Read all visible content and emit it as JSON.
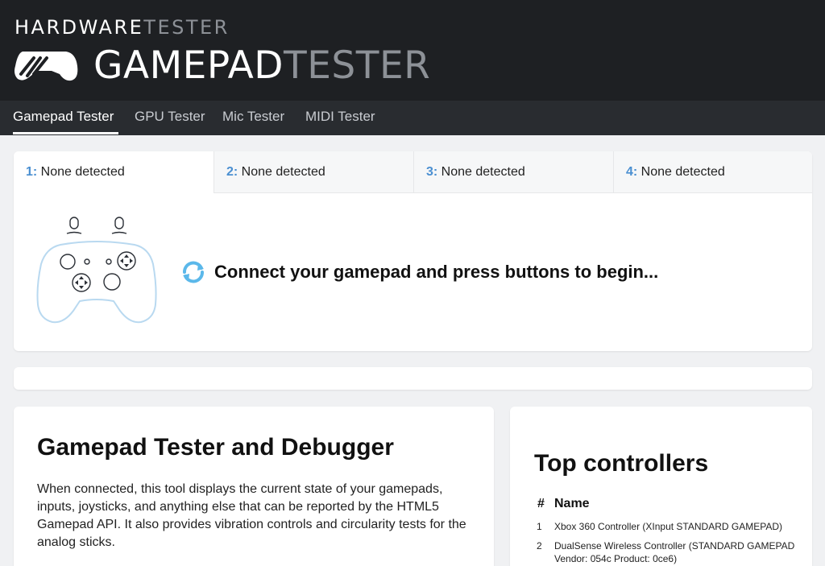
{
  "brand": {
    "top_white": "HARDWARE",
    "top_gray": "TESTER",
    "main_white": "GAMEPAD",
    "main_gray": "TESTER",
    "logo_icon": "gamepad-logo-icon"
  },
  "nav": {
    "items": [
      {
        "label": "Gamepad Tester",
        "active": true
      },
      {
        "label": "GPU Tester",
        "active": false
      },
      {
        "label": "Mic Tester",
        "active": false
      },
      {
        "label": "MIDI Tester",
        "active": false
      }
    ]
  },
  "tabs": [
    {
      "num": "1:",
      "label": " None detected"
    },
    {
      "num": "2:",
      "label": " None detected"
    },
    {
      "num": "3:",
      "label": " None detected"
    },
    {
      "num": "4:",
      "label": " None detected"
    }
  ],
  "tester": {
    "message": "Connect your gamepad and press buttons to begin...",
    "refresh_icon": "refresh-icon",
    "illustration_icon": "gamepad-outline-icon"
  },
  "info": {
    "title": "Gamepad Tester and Debugger",
    "description": "When connected, this tool displays the current state of your gamepads, inputs, joysticks, and anything else that can be reported by the HTML5 Gamepad API. It also provides vibration controls and circularity tests for the analog sticks."
  },
  "top_controllers": {
    "title": "Top controllers",
    "columns": [
      "#",
      "Name"
    ],
    "rows": [
      {
        "num": "1",
        "name": "Xbox 360 Controller (XInput STANDARD GAMEPAD)"
      },
      {
        "num": "2",
        "name": "DualSense Wireless Controller (STANDARD GAMEPAD Vendor: 054c Product: 0ce6)"
      }
    ]
  },
  "colors": {
    "header_bg": "#1e2023",
    "nav_bg": "#292c30",
    "accent_blue": "#4a8fd1",
    "refresh_blue": "#5bb8ea",
    "page_bg": "#f0f1f3"
  }
}
